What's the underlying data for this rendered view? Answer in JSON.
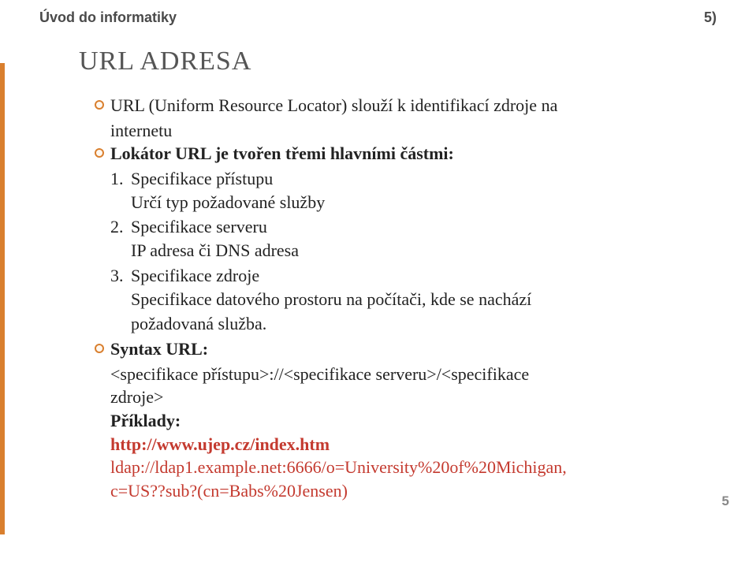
{
  "header": {
    "course": "Úvod do informatiky",
    "slide_no": "5)"
  },
  "title": "URL ADRESA",
  "bullets": {
    "b1a": "URL (Uniform Resource Locator) slouží k identifikací zdroje na",
    "b1b": "internetu",
    "b2": "Lokátor URL je tvořen třemi hlavními částmi:",
    "syntax_label": "Syntax URL:"
  },
  "list": {
    "n1": "1.",
    "t1": "Specifikace přístupu",
    "s1": "Určí typ požadované služby",
    "n2": "2.",
    "t2": "Specifikace serveru",
    "s2": "IP adresa či DNS adresa",
    "n3": "3.",
    "t3": "Specifikace zdroje",
    "s3a": "Specifikace datového prostoru na počítači, kde se nachází",
    "s3b": "požadovaná služba."
  },
  "syntax": {
    "line1": "<specifikace přístupu>://<specifikace serveru>/<specifikace",
    "line2": "zdroje>"
  },
  "examples": {
    "label": "Příklady:",
    "ex1": "http://www.ujep.cz/index.htm",
    "ex2a": "ldap://ldap1.example.net:6666/o=University%20of%20Michigan,",
    "ex2b": "c=US??sub?(cn=Babs%20Jensen)"
  },
  "page_number": "5"
}
